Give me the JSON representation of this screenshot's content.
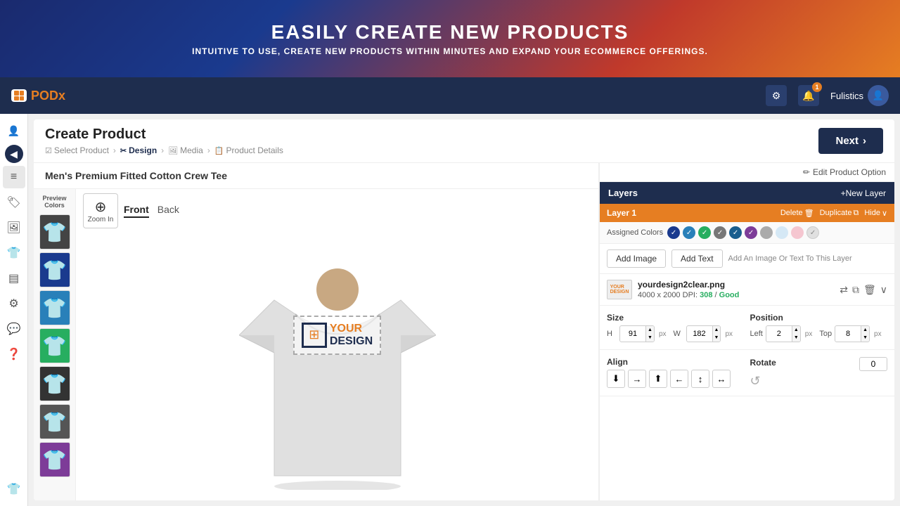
{
  "hero": {
    "title": "EASILY CREATE NEW PRODUCTS",
    "subtitle": "INTUITIVE TO USE, CREATE NEW PRODUCTS WITHIN MINUTES AND EXPAND YOUR ECOMMERCE OFFERINGS."
  },
  "topnav": {
    "logo_text_pod": "POD",
    "logo_text_x": "x",
    "settings_icon": "⚙",
    "notification_icon": "🔔",
    "notification_count": "1",
    "user_name": "Fulistics",
    "user_icon": "👤"
  },
  "page": {
    "title": "Create Product",
    "breadcrumbs": [
      {
        "label": "Select Product",
        "active": false
      },
      {
        "label": "Design",
        "active": true
      },
      {
        "label": "Media",
        "active": false
      },
      {
        "label": "Product Details",
        "active": false
      }
    ],
    "next_button": "Next"
  },
  "product": {
    "name": "Men's Premium Fitted Cotton Crew Tee"
  },
  "design_toolbar": {
    "zoom_icon": "⊕",
    "zoom_label": "Zoom In",
    "front_tab": "Front",
    "back_tab": "Back"
  },
  "tshirt": {
    "color": "#e8e8e8"
  },
  "sidebar": {
    "icons": [
      "👤",
      "≡",
      "🏷",
      "🖼",
      "👕",
      "▤",
      "⚙",
      "💬",
      "❓"
    ],
    "bottom_icon": "👕"
  },
  "color_swatches": {
    "label": "Preview\nColors",
    "colors": [
      "#222",
      "#1a3a8e",
      "#2980b9",
      "#27ae60",
      "#111",
      "#333",
      "#7d3c98"
    ]
  },
  "layers_panel": {
    "layers_label": "Layers",
    "new_layer_btn": "+New Layer",
    "layer1": {
      "name": "Layer 1",
      "delete_btn": "Delete",
      "duplicate_btn": "Duplicate",
      "hide_btn": "Hide"
    },
    "assigned_colors_label": "Assigned Colors",
    "color_checkboxes": [
      {
        "color": "#1a3a8e",
        "checked": true
      },
      {
        "color": "#2980b9",
        "checked": true
      },
      {
        "color": "#27ae60",
        "checked": true
      },
      {
        "color": "#555",
        "checked": true
      },
      {
        "color": "#1a5e8e",
        "checked": true
      },
      {
        "color": "#7d3c98",
        "checked": true
      },
      {
        "color": "#aaa",
        "checked": false
      },
      {
        "color": "#d5e8f5",
        "checked": false
      },
      {
        "color": "#f5c6d0",
        "checked": false
      },
      {
        "color": "#e0e0e0",
        "checked": true
      }
    ],
    "add_image_btn": "Add Image",
    "add_text_btn": "Add Text",
    "add_hint": "Add An Image Or Text To This Layer",
    "design_file": {
      "filename": "yourdesign2clear.png",
      "dimensions": "4000 x 2000",
      "dpi_label": "DPI:",
      "dpi_value": "308",
      "dpi_quality": "Good",
      "swap_icon": "⇄",
      "copy_icon": "⧉",
      "delete_icon": "🗑"
    },
    "size": {
      "label": "Size",
      "h_label": "H",
      "h_value": "91",
      "w_label": "W",
      "w_value": "182",
      "unit": "px"
    },
    "position": {
      "label": "Position",
      "left_label": "Left",
      "left_value": "2",
      "top_label": "Top",
      "top_value": "8",
      "unit": "px"
    },
    "align": {
      "label": "Align",
      "buttons": [
        "⬇",
        "→",
        "⬆",
        "←",
        "↕",
        "↔"
      ]
    },
    "rotate": {
      "label": "Rotate",
      "value": "0"
    },
    "edit_product_option": "Edit Product Option"
  }
}
